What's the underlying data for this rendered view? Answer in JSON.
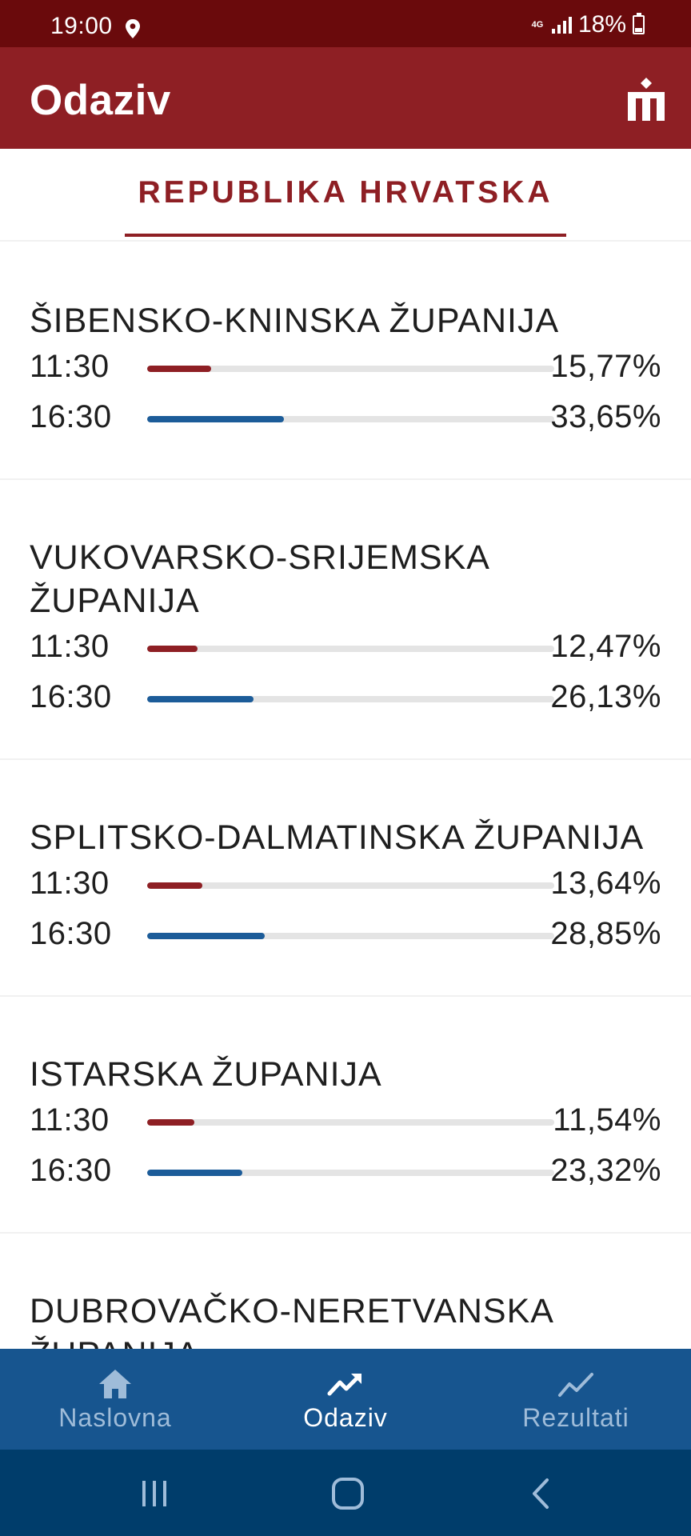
{
  "status_bar": {
    "time": "19:00",
    "network": "4G",
    "battery": "18%",
    "icons": [
      "location-pin-icon",
      "signal-icon",
      "battery-icon"
    ]
  },
  "app_bar": {
    "title": "Odaziv",
    "logo_icon": "ballot-box-logo-icon"
  },
  "country_tab": {
    "label": "REPUBLIKA HRVATSKA"
  },
  "colors": {
    "primary_red": "#8e1f24",
    "status_dark_red": "#6a0a0c",
    "bar_red": "#8e1f24",
    "bar_blue": "#1c5c99",
    "nav_blue": "#17558f",
    "system_nav_blue": "#003d6b"
  },
  "counties": [
    {
      "title": "ŠIBENSKO-KNINSKA ŽUPANIJA",
      "rows": [
        {
          "time": "11:30",
          "percent_label": "15,77%",
          "value": 15.77,
          "color": "#8e1f24"
        },
        {
          "time": "16:30",
          "percent_label": "33,65%",
          "value": 33.65,
          "color": "#1c5c99"
        }
      ]
    },
    {
      "title": "VUKOVARSKO-SRIJEMSKA ŽUPANIJA",
      "rows": [
        {
          "time": "11:30",
          "percent_label": "12,47%",
          "value": 12.47,
          "color": "#8e1f24"
        },
        {
          "time": "16:30",
          "percent_label": "26,13%",
          "value": 26.13,
          "color": "#1c5c99"
        }
      ]
    },
    {
      "title": "SPLITSKO-DALMATINSKA ŽUPANIJA",
      "rows": [
        {
          "time": "11:30",
          "percent_label": "13,64%",
          "value": 13.64,
          "color": "#8e1f24"
        },
        {
          "time": "16:30",
          "percent_label": "28,85%",
          "value": 28.85,
          "color": "#1c5c99"
        }
      ]
    },
    {
      "title": "ISTARSKA ŽUPANIJA",
      "rows": [
        {
          "time": "11:30",
          "percent_label": "11,54%",
          "value": 11.54,
          "color": "#8e1f24"
        },
        {
          "time": "16:30",
          "percent_label": "23,32%",
          "value": 23.32,
          "color": "#1c5c99"
        }
      ]
    },
    {
      "title": "DUBROVAČKO-NERETVANSKA ŽUPANIJA",
      "rows": []
    }
  ],
  "bottom_nav": {
    "items": [
      {
        "label": "Naslovna",
        "icon": "home-icon",
        "active": false
      },
      {
        "label": "Odaziv",
        "icon": "trending-up-icon",
        "active": true
      },
      {
        "label": "Rezultati",
        "icon": "line-chart-icon",
        "active": false
      }
    ]
  },
  "system_nav": {
    "buttons": [
      "recent-apps-icon",
      "home-button-icon",
      "back-icon"
    ]
  }
}
